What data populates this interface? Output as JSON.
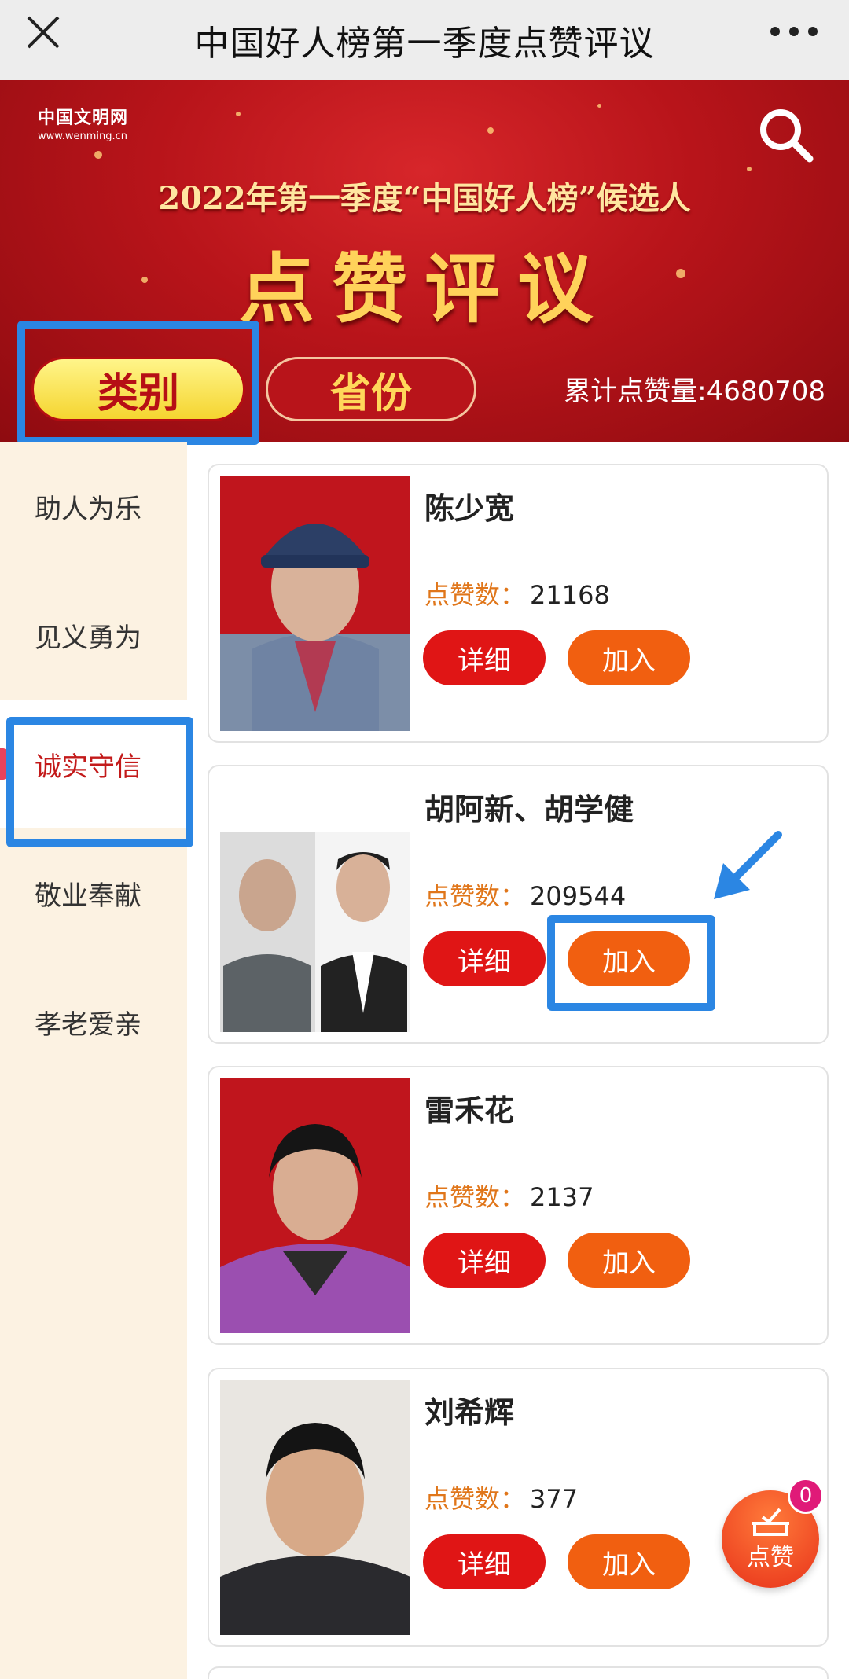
{
  "topbar": {
    "title": "中国好人榜第一季度点赞评议"
  },
  "banner": {
    "logo_cn": "中国文明网",
    "logo_url": "www.wenming.cn",
    "subtitle": "2022年第一季度“中国好人榜”候选人",
    "title": "点赞评议",
    "tab_category": "类别",
    "tab_province": "省份",
    "total_label": "累计点赞量:",
    "total_value": "4680708"
  },
  "sidebar": {
    "items": [
      {
        "label": "助人为乐"
      },
      {
        "label": "见义勇为"
      },
      {
        "label": "诚实守信"
      },
      {
        "label": "敬业奉献"
      },
      {
        "label": "孝老爱亲"
      }
    ],
    "active_index": 2
  },
  "cards": [
    {
      "name": "陈少宽",
      "likes_label": "点赞数：",
      "likes": "21168",
      "detail": "详细",
      "join": "加入"
    },
    {
      "name": "胡阿新、胡学健",
      "likes_label": "点赞数：",
      "likes": "209544",
      "detail": "详细",
      "join": "加入"
    },
    {
      "name": "雷禾花",
      "likes_label": "点赞数：",
      "likes": "2137",
      "detail": "详细",
      "join": "加入"
    },
    {
      "name": "刘希辉",
      "likes_label": "点赞数：",
      "likes": "377",
      "detail": "详细",
      "join": "加入"
    }
  ],
  "fab": {
    "label": "点赞",
    "badge": "0"
  },
  "colors": {
    "banner_red": "#b8141a",
    "accent_blue": "#2b86e3",
    "join_orange": "#f15f10",
    "detail_red": "#e01515"
  }
}
